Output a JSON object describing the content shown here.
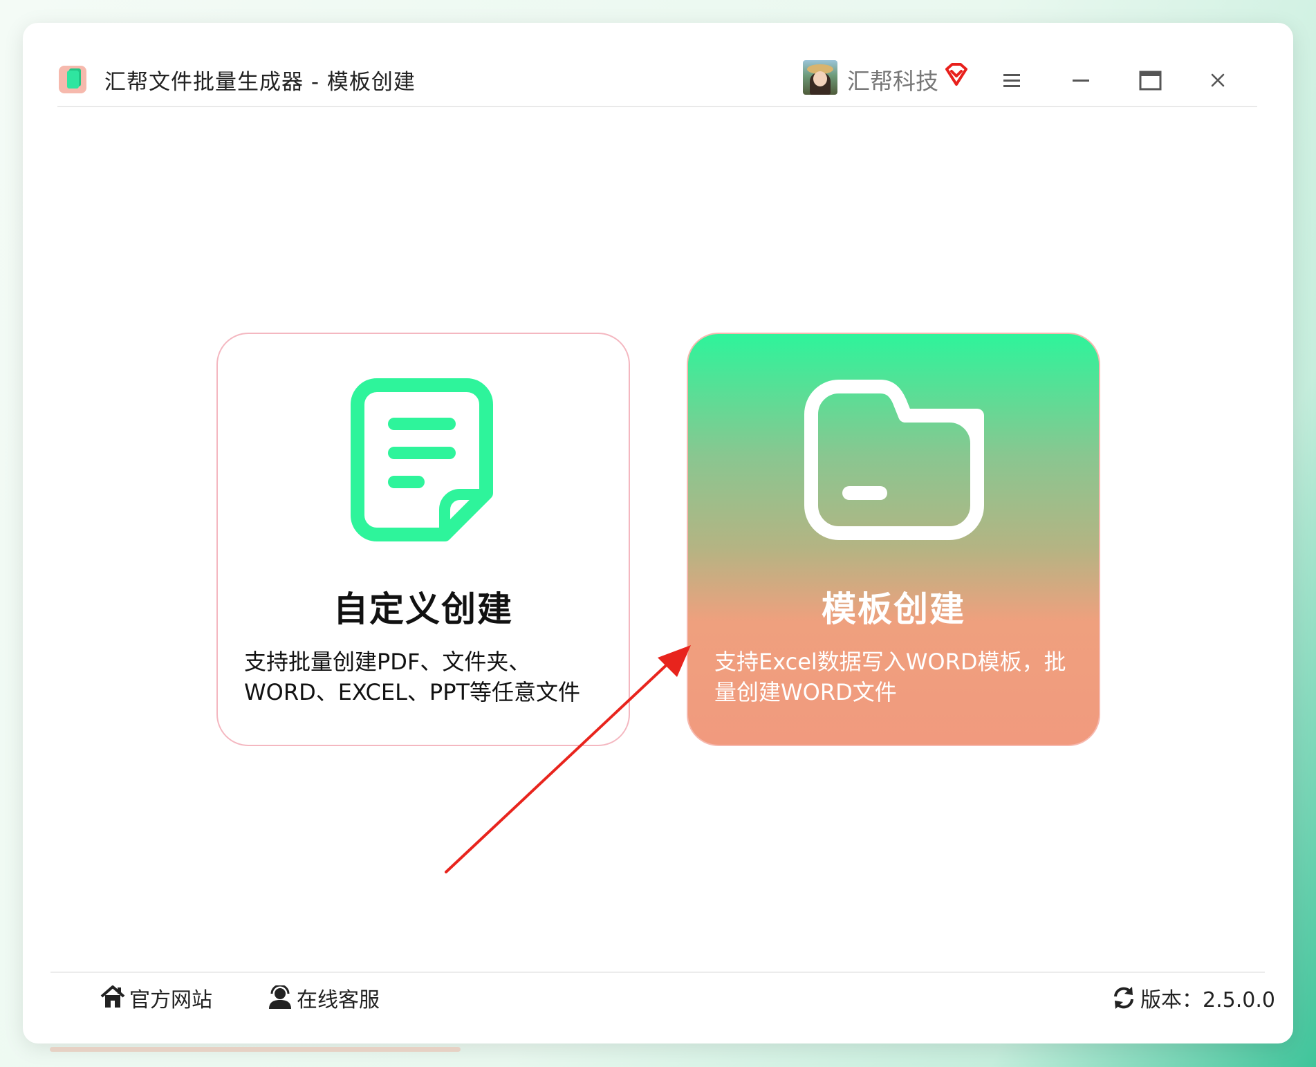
{
  "window": {
    "title": "汇帮文件批量生成器 - 模板创建",
    "account_name": "汇帮科技"
  },
  "icons": {
    "app": "app-icon",
    "avatar": "avatar",
    "vip": "vip-diamond-icon",
    "menu": "menu-icon",
    "minimize": "minimize-icon",
    "maximize": "maximize-icon",
    "close": "close-icon",
    "document": "document-icon",
    "folder": "folder-icon",
    "home": "home-icon",
    "service": "headset-icon",
    "refresh": "refresh-icon"
  },
  "cards": [
    {
      "title": "自定义创建",
      "desc_line1": "支持批量创建PDF、文件夹、",
      "desc_line2": "WORD、EXCEL、PPT等任意文件"
    },
    {
      "title": "模板创建",
      "desc_line1": "支持Excel数据写入WORD模板，批",
      "desc_line2": "量创建WORD文件"
    }
  ],
  "footer": {
    "website": "官方网站",
    "service": "在线客服",
    "version": "版本：2.5.0.0"
  },
  "colors": {
    "accent_green": "#2ef49b",
    "card_salmon": "#f19a7e",
    "arrow_red": "#e8241d",
    "vip_red": "#e8201c"
  }
}
